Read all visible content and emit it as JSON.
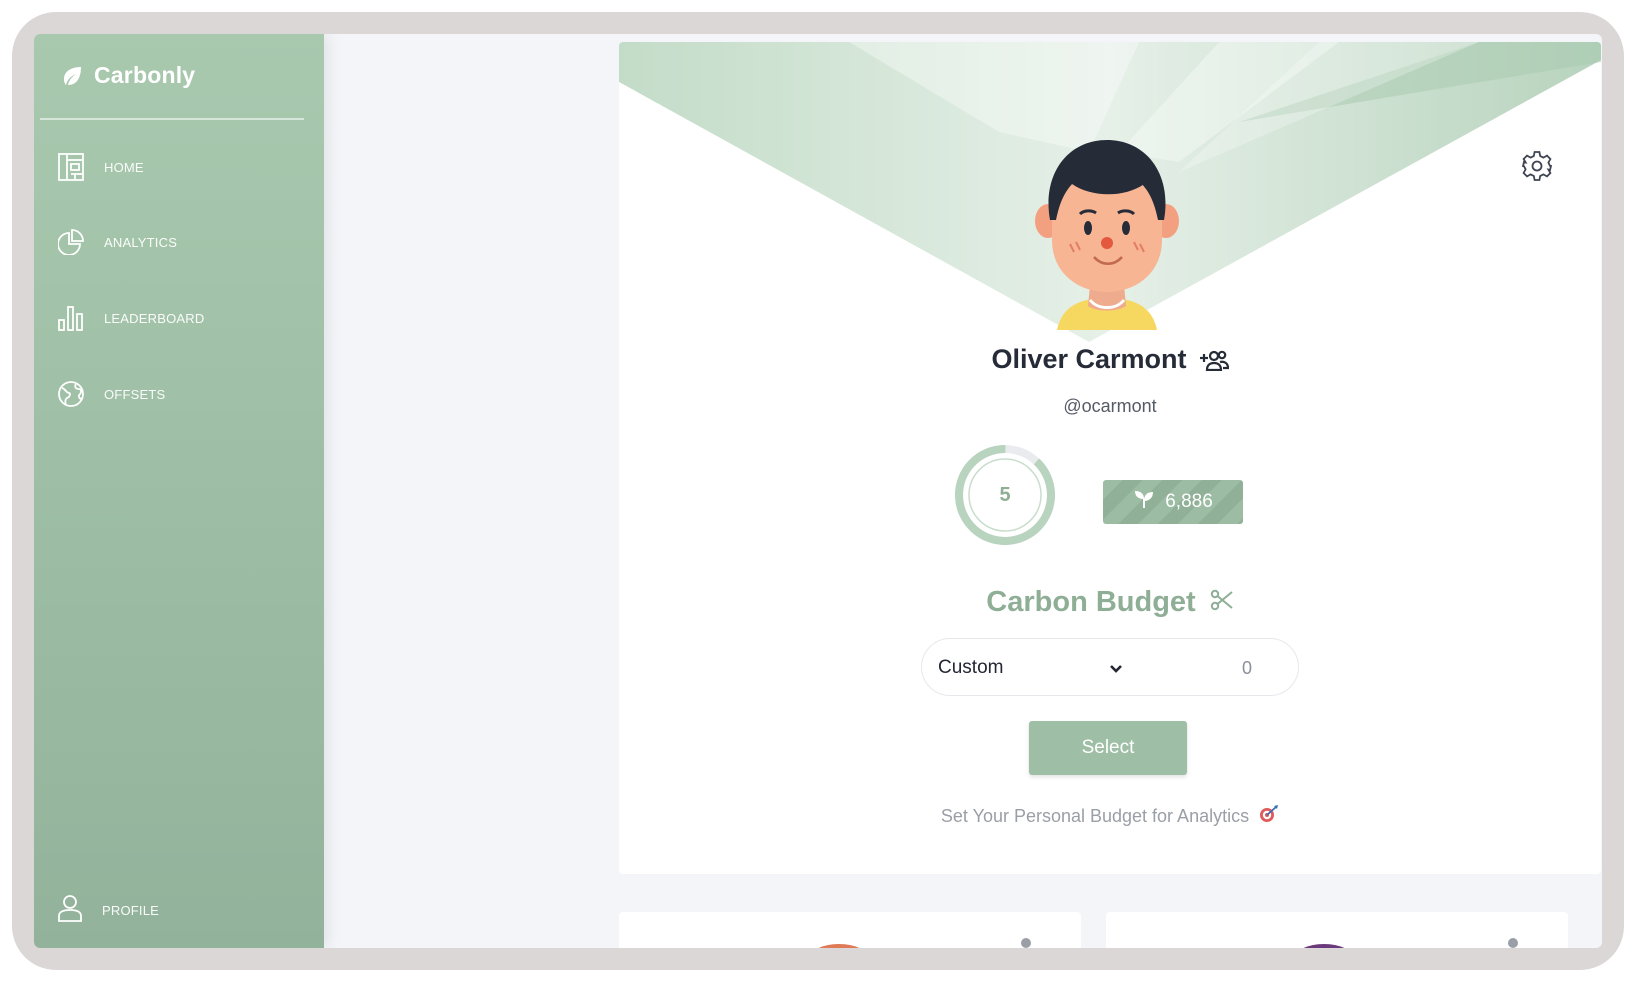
{
  "app": {
    "name": "Carbonly"
  },
  "sidebar": {
    "items": [
      {
        "label": "HOME",
        "icon": "home-layout-icon"
      },
      {
        "label": "ANALYTICS",
        "icon": "pie-chart-icon"
      },
      {
        "label": "LEADERBOARD",
        "icon": "bar-chart-icon"
      },
      {
        "label": "OFFSETS",
        "icon": "globe-icon"
      }
    ],
    "profile": {
      "label": "PROFILE",
      "icon": "user-icon"
    }
  },
  "profile": {
    "name": "Oliver Carmont",
    "handle": "@ocarmont",
    "level": "5",
    "level_progress": 0.88,
    "points": "6,886"
  },
  "budget": {
    "title": "Carbon Budget",
    "dropdown_value": "Custom",
    "amount": "0",
    "select_label": "Select",
    "hint": "Set Your Personal Budget for Analytics"
  },
  "colors": {
    "accent": "#8fae96",
    "sidebar": "#a3c3aa",
    "text_dark": "#262b38"
  }
}
